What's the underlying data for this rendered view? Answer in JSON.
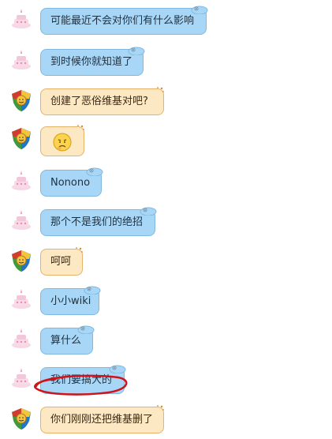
{
  "messages": [
    {
      "sender": "cake",
      "text": "可能最近不会对你们有什么影响",
      "style": "blue"
    },
    {
      "sender": "cake",
      "text": "到时候你就知道了",
      "style": "blue"
    },
    {
      "sender": "shield",
      "text": "创建了恶俗维基对吧?",
      "style": "cream"
    },
    {
      "sender": "shield",
      "text": "",
      "style": "cream-emoji",
      "emoji": "worried-face"
    },
    {
      "sender": "cake",
      "text": "Nonono",
      "style": "blue"
    },
    {
      "sender": "cake",
      "text": "那个不是我们的绝招",
      "style": "blue"
    },
    {
      "sender": "shield",
      "text": "呵呵",
      "style": "cream"
    },
    {
      "sender": "cake",
      "text": "小小wiki",
      "style": "blue"
    },
    {
      "sender": "cake",
      "text": "算什么",
      "style": "blue"
    },
    {
      "sender": "cake",
      "text": "我们要搞大的",
      "style": "blue",
      "highlighted": true
    },
    {
      "sender": "shield",
      "text": "你们刚刚还把维基删了",
      "style": "cream"
    }
  ],
  "colors": {
    "blue_bubble": "#a8d6f6",
    "blue_border": "#7fb9e2",
    "cream_bubble": "#fde8c4",
    "cream_border": "#e8b26a",
    "highlight": "#d0121b"
  },
  "icons": {
    "cake_avatar": "cake-avatar-icon",
    "shield_avatar": "shield-avatar-icon",
    "bubble_decoration": "bubble-deco-icon",
    "emoji": "worried-face-icon"
  }
}
